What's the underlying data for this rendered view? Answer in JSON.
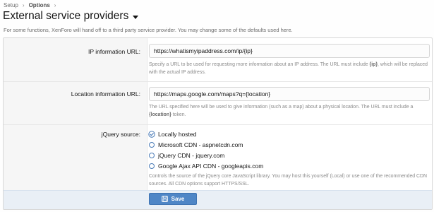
{
  "breadcrumb": [
    {
      "label": "Setup"
    },
    {
      "label": "Options"
    }
  ],
  "page": {
    "title": "External service providers",
    "description": "For some functions, XenForo will hand off to a third party service provider. You may change some of the defaults used here."
  },
  "fields": {
    "ip_lookup": {
      "label": "IP information URL:",
      "value": "https://whatismyipaddress.com/ip/{ip}",
      "explain_before": "Specify a URL to be used for requesting more information about an IP address. The URL must include ",
      "explain_token": "{ip}",
      "explain_after": ", which will be replaced with the actual IP address."
    },
    "location": {
      "label": "Location information URL:",
      "value": "https://maps.google.com/maps?q={location}",
      "explain_before": "The URL specified here will be used to give information (such as a map) about a physical location. The URL must include a ",
      "explain_token": "{location}",
      "explain_after": " token."
    },
    "jquery_source": {
      "label": "jQuery source:",
      "options": [
        {
          "label": "Locally hosted",
          "checked": true
        },
        {
          "label": "Microsoft CDN - aspnetcdn.com",
          "checked": false
        },
        {
          "label": "jQuery CDN - jquery.com",
          "checked": false
        },
        {
          "label": "Google Ajax API CDN - googleapis.com",
          "checked": false
        }
      ],
      "explain": "Controls the source of the jQuery core JavaScript library. You may host this yourself (Local) or use one of the recommended CDN sources. All CDN options support HTTPS/SSL."
    }
  },
  "footer": {
    "save_label": "Save",
    "save_icon": "floppy-disk-icon"
  },
  "colors": {
    "accent": "#4f86c6",
    "footer_bg": "#e9eff6",
    "label_bg": "#f6f6f6"
  }
}
